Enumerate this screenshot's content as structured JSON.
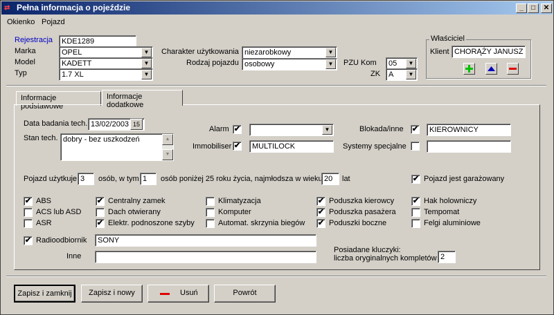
{
  "window": {
    "title": "Pełna informacja o pojeździe"
  },
  "menu": {
    "items": [
      "Okienko",
      "Pojazd"
    ]
  },
  "header": {
    "rejestracja_label": "Rejestracja",
    "rejestracja_value": "KDE1289",
    "marka_label": "Marka",
    "marka_value": "OPEL",
    "model_label": "Model",
    "model_value": "KADETT",
    "typ_label": "Typ",
    "typ_value": "1.7 XL",
    "charakter_label": "Charakter użytkowania",
    "charakter_value": "niezarobkowy",
    "rodzaj_label": "Rodzaj pojazdu",
    "rodzaj_value": "osobowy",
    "pzu_label": "PZU Kom",
    "pzu_value": "05",
    "zk_label": "ZK",
    "zk_value": "A",
    "owner_group_label": "Właściciel",
    "klient_label": "Klient",
    "klient_value": "CHORĄŻY JANUSZ"
  },
  "tabs": [
    "Informacje podstawowe",
    "Informacje dodatkowe"
  ],
  "details": {
    "data_badania_label": "Data badania tech.",
    "data_badania_value": "13/02/2003",
    "calendar_label": "15",
    "stan_label": "Stan tech.",
    "stan_value": "dobry - bez uszkodzeń",
    "alarm_label": "Alarm",
    "alarm_checked": "✔",
    "alarm_value": "",
    "immobiliser_label": "Immobiliser",
    "immobiliser_checked": "✔",
    "immobiliser_value": "MULTILOCK",
    "blokada_label": "Blokada/inne",
    "blokada_checked": "✔",
    "blokada_value": "KIEROWNICY",
    "systemy_label": "Systemy specjalne",
    "systemy_checked": "",
    "systemy_value": "",
    "usage_part1": "Pojazd użytkuje",
    "usage_count": "3",
    "usage_part2": "osób, w tym",
    "usage_young": "1",
    "usage_part3": "osób poniżej 25 roku życia, najmłodsza w wieku",
    "usage_age": "20",
    "usage_part4": "lat",
    "garaz_label": "Pojazd jest garażowany",
    "garaz_checked": "✔",
    "radio_label": "Radioodbiornik",
    "radio_checked": "✔",
    "radio_value": "SONY",
    "inne_label": "Inne",
    "inne_value": "",
    "keys_label1": "Posiadane kluczyki:",
    "keys_label2": "liczba oryginalnych kompletów",
    "keys_value": "2"
  },
  "equipment": [
    {
      "label": "ABS",
      "checked": "✔"
    },
    {
      "label": "ACS lub ASD",
      "checked": ""
    },
    {
      "label": "ASR",
      "checked": ""
    },
    {
      "label": "Centralny zamek",
      "checked": "✔"
    },
    {
      "label": "Dach otwierany",
      "checked": ""
    },
    {
      "label": "Elektr. podnoszone szyby",
      "checked": "✔"
    },
    {
      "label": "Klimatyzacja",
      "checked": ""
    },
    {
      "label": "Komputer",
      "checked": ""
    },
    {
      "label": "Automat. skrzynia biegów",
      "checked": ""
    },
    {
      "label": "Poduszka kierowcy",
      "checked": "✔"
    },
    {
      "label": "Poduszka pasażera",
      "checked": "✔"
    },
    {
      "label": "Poduszki boczne",
      "checked": "✔"
    },
    {
      "label": "Hak holowniczy",
      "checked": "✔"
    },
    {
      "label": "Tempomat",
      "checked": ""
    },
    {
      "label": "Felgi aluminiowe",
      "checked": ""
    }
  ],
  "buttons": {
    "save_close": "Zapisz i zamknij",
    "save_new": "Zapisz i nowy",
    "delete": "Usuń",
    "back": "Powrót"
  },
  "colors": {
    "add": "#00c000",
    "up": "#0000c0",
    "remove": "#e00000",
    "link_blue": "#0000c0"
  }
}
